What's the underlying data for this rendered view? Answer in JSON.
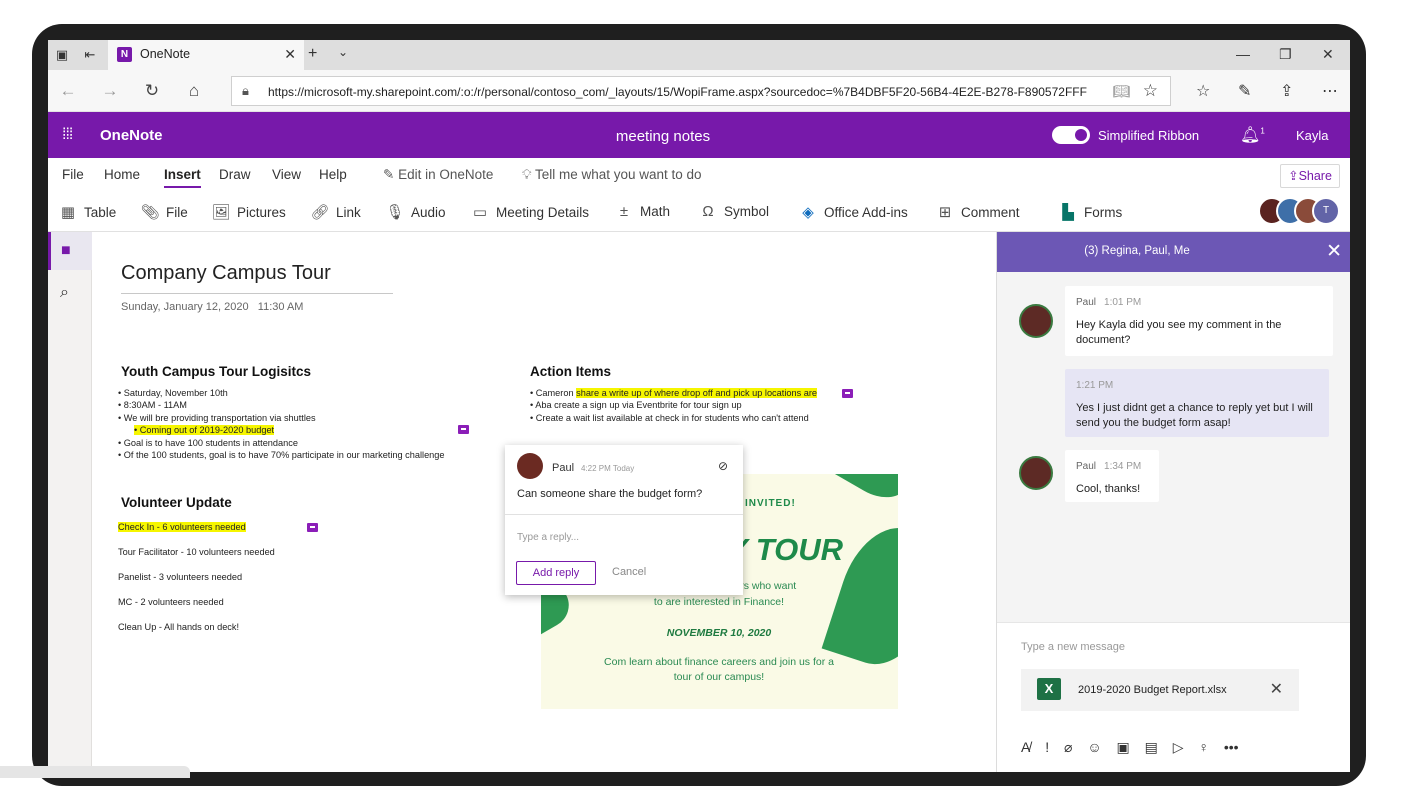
{
  "browser": {
    "tab_title": "OneNote",
    "url": "https://microsoft-my.sharepoint.com/:o:/r/personal/contoso_com/_layouts/15/WopiFrame.aspx?sourcedoc=%7B4DBF5F20-56B4-4E2E-B278-F890572FFF"
  },
  "app": {
    "name": "OneNote",
    "doc_title": "meeting notes",
    "toggle_label": "Simplified Ribbon",
    "notification_count": "1",
    "user_name": "Kayla",
    "brand_color": "#7719aa"
  },
  "menu": {
    "items": [
      "File",
      "Home",
      "Insert",
      "Draw",
      "View",
      "Help"
    ],
    "active": "Insert",
    "edit_in_app": "Edit in OneNote",
    "tell_me": "Tell me what you want to do",
    "share": "Share"
  },
  "ribbon": {
    "buttons": [
      "Table",
      "File",
      "Pictures",
      "Link",
      "Audio",
      "Meeting Details",
      "Math",
      "Symbol",
      "Office Add-ins",
      "Comment",
      "Forms"
    ]
  },
  "page": {
    "title": "Company Campus Tour",
    "date": "Sunday, January 12, 2020",
    "time": "11:30 AM",
    "logistics": {
      "heading": "Youth Campus Tour Logisitcs",
      "bullets": [
        "• Saturday, November 10th",
        "• 8:30AM - 11AM",
        "• We will bre providing transportation via shuttles",
        "• Coming out of 2019-2020 budget",
        "• Goal is to have 100 students in attendance",
        "• Of the 100 students, goal is to have 70% participate in our marketing challenge"
      ]
    },
    "action_items": {
      "heading": "Action Items",
      "line1_prefix": "• Cameron ",
      "line1_highlight": "share a write up of where drop off and pick up locations are",
      "line2": "• Aba create a sign up via Eventbrite for tour sign up",
      "line3": "• Create a wait list available at check in for students who can't attend"
    },
    "volunteer": {
      "heading": "Volunteer Update",
      "items": [
        "Check In - 6 volunteers needed",
        "Tour Facilitator - 10 volunteers needed",
        "Panelist - 3 volunteers needed",
        "MC - 2 volunteers needed",
        "Clean Up - All hands on deck!"
      ]
    },
    "invite": {
      "invited": "INVITED!",
      "tour": "Y TOUR",
      "line1": "enagers who want",
      "line2": "to are interested in Finance!",
      "date": "NOVEMBER 10, 2020",
      "line3": "Com learn about finance careers and join us for a",
      "line4": "tour of our campus!"
    }
  },
  "comment": {
    "author": "Paul",
    "time": "4:22 PM Today",
    "text": "Can someone share the budget form?",
    "reply_placeholder": "Type a reply...",
    "add_reply": "Add reply",
    "cancel": "Cancel"
  },
  "chat": {
    "title": "(3) Regina, Paul, Me",
    "messages": [
      {
        "author": "Paul",
        "time": "1:01 PM",
        "text": "Hey Kayla did you see my comment in the document?"
      },
      {
        "author": "",
        "time": "1:21 PM",
        "text": "Yes I just didnt get a chance to reply yet but I will send you the budget form asap!"
      },
      {
        "author": "Paul",
        "time": "1:34 PM",
        "text": "Cool, thanks!"
      }
    ],
    "compose_placeholder": "Type a new message",
    "attachment": "2019-2020 Budget Report.xlsx"
  }
}
